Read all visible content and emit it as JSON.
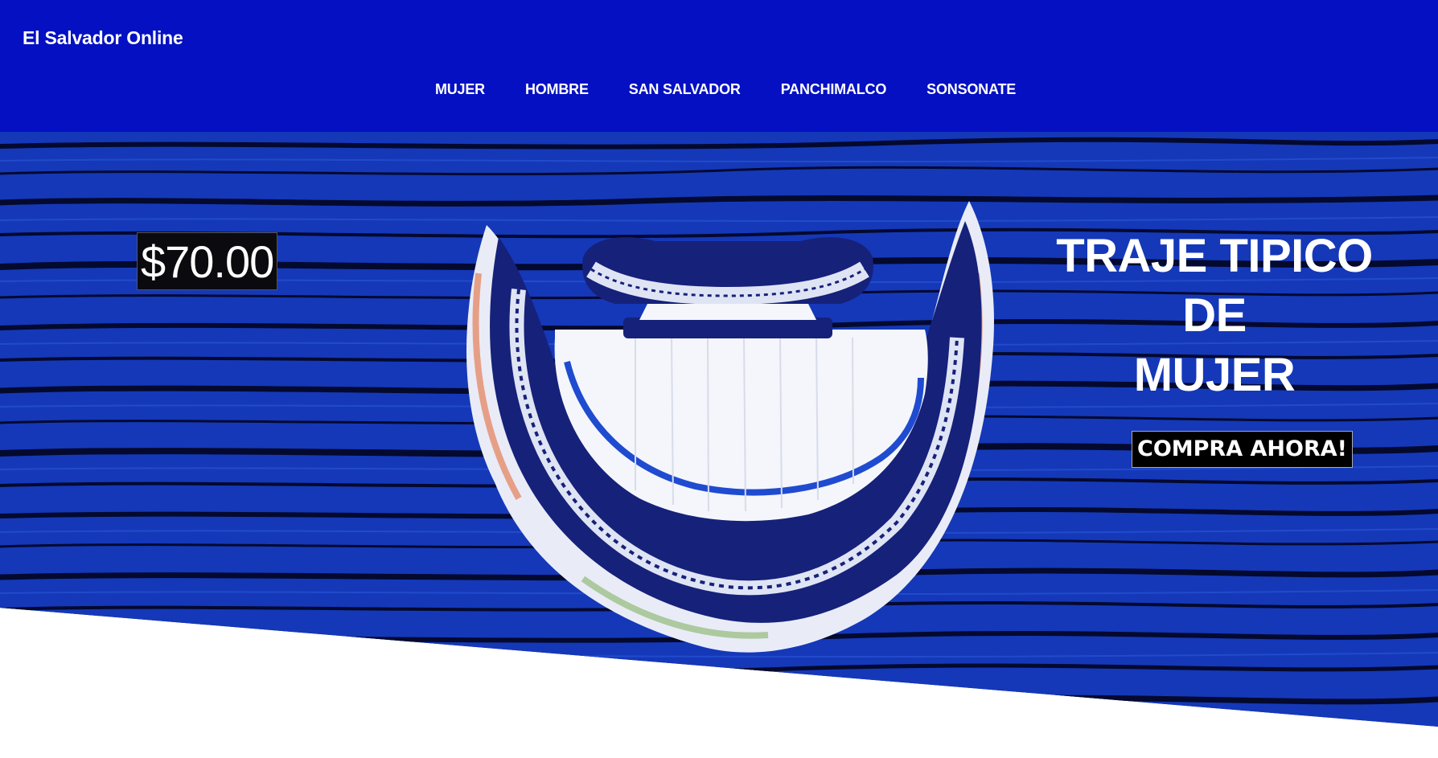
{
  "brand": {
    "name": "El Salvador Online"
  },
  "nav": {
    "items": [
      {
        "label": "MUJER"
      },
      {
        "label": "HOMBRE"
      },
      {
        "label": "SAN SALVADOR"
      },
      {
        "label": "PANCHIMALCO"
      },
      {
        "label": "SONSONATE"
      }
    ]
  },
  "hero": {
    "price": "$70.00",
    "title_lines": [
      "TRAJE TIPICO",
      "DE",
      "MUJER"
    ],
    "cta_label": "COMPRA AHORA!",
    "image": "traje-tipico-dress-image"
  },
  "colors": {
    "header_bg": "#0410c2",
    "hero_bg": "#1233ad",
    "dress_navy": "#16217a",
    "dress_white": "#f4f6fb"
  }
}
